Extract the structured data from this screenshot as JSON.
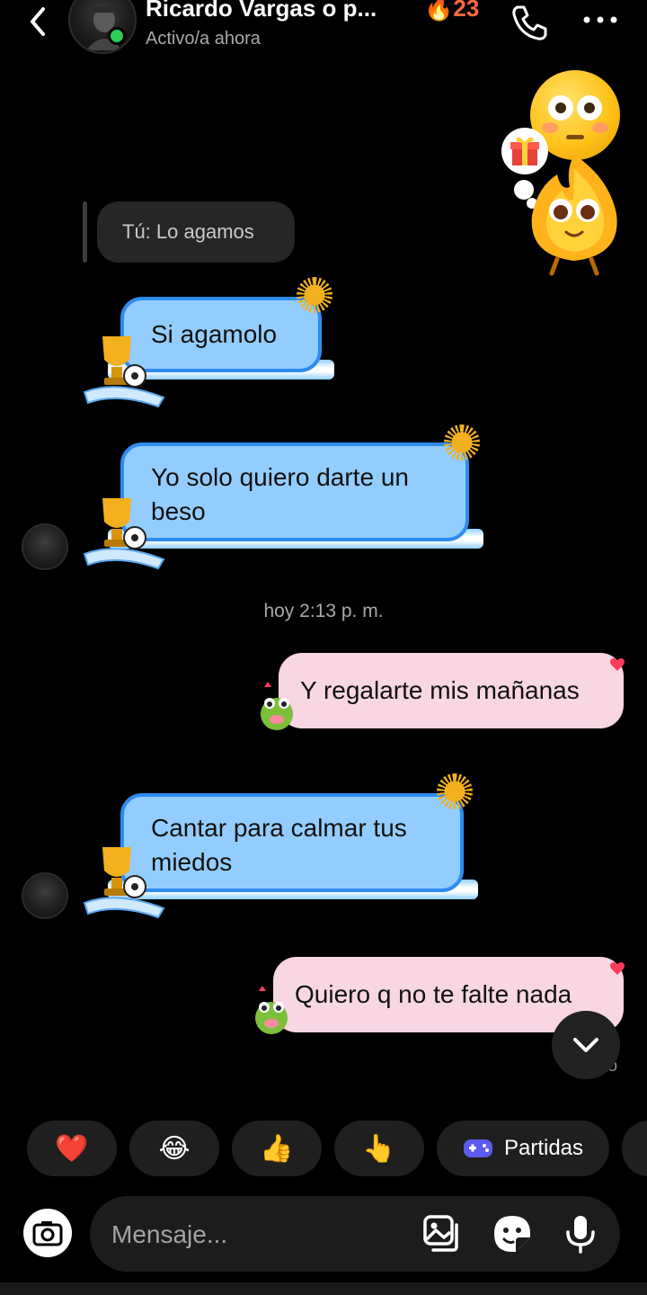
{
  "header": {
    "name": "Ricardo Vargas o p...",
    "streak": "🔥23",
    "status": "Activo/a ahora",
    "icons": {
      "back": "chevron-left-icon",
      "call": "phone-icon",
      "more": "more-horizontal-icon"
    }
  },
  "reply": {
    "text": "Tú: Lo agamos"
  },
  "messages": [
    {
      "side": "incoming",
      "theme": "blue",
      "text": "Si agamolo"
    },
    {
      "side": "incoming",
      "theme": "blue",
      "text": "Yo solo quiero darte un beso"
    },
    {
      "side": "outgoing",
      "theme": "pink",
      "text": "Y regalarte mis mañanas"
    },
    {
      "side": "incoming",
      "theme": "blue",
      "text": "Cantar para calmar tus miedos"
    },
    {
      "side": "outgoing",
      "theme": "pink",
      "text": "Quiero q no te falte nada"
    }
  ],
  "timestamp": "hoy 2:13 p. m.",
  "seen_partial": "o",
  "reactions": [
    {
      "emoji": "❤️",
      "icon": "heart-icon"
    },
    {
      "emoji": "😂",
      "icon": "laughing-icon"
    },
    {
      "emoji": "👍",
      "icon": "thumbs-up-icon"
    },
    {
      "emoji": "👆",
      "icon": "pointing-up-icon"
    },
    {
      "label": "Partidas",
      "icon": "gamepad-icon"
    }
  ],
  "composer": {
    "placeholder": "Mensaje...",
    "icons": [
      "camera-icon",
      "gallery-icon",
      "sticker-icon",
      "microphone-icon"
    ]
  },
  "colors": {
    "background": "#000000",
    "blue_bubble": "#93cdff",
    "blue_border": "#2e8cf0",
    "pink_bubble": "#f9d6e3",
    "online": "#2ecc55",
    "streak": "#ff6a3d"
  }
}
